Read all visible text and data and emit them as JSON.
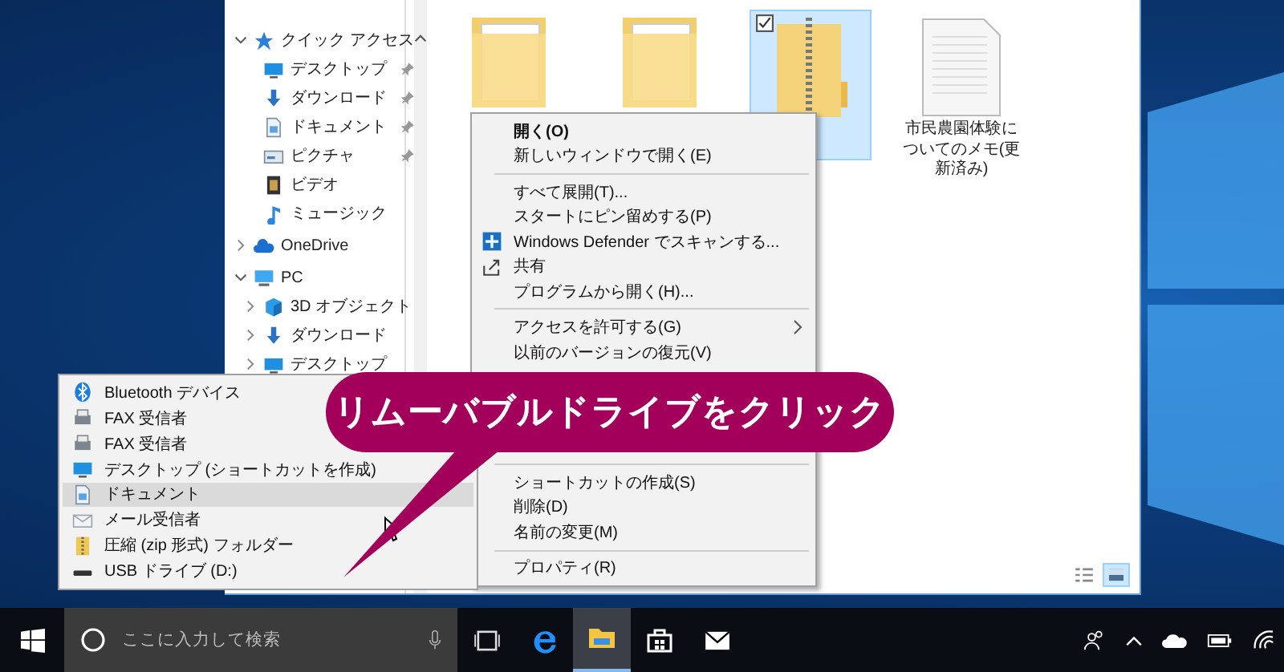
{
  "nav_pane": {
    "items": [
      {
        "label": "クイック アクセス",
        "expanded": true,
        "children": [
          {
            "label": "デスクトップ",
            "pinned": true
          },
          {
            "label": "ダウンロード",
            "pinned": true
          },
          {
            "label": "ドキュメント",
            "pinned": true
          },
          {
            "label": "ピクチャ",
            "pinned": true
          },
          {
            "label": "ビデオ",
            "pinned": false
          },
          {
            "label": "ミュージック",
            "pinned": false
          }
        ]
      },
      {
        "label": "OneDrive",
        "expanded": false
      },
      {
        "label": "PC",
        "expanded": true,
        "children": [
          {
            "label": "3D オブジェクト",
            "expanded": false
          },
          {
            "label": "ダウンロード",
            "expanded": false
          },
          {
            "label": "デスクトップ",
            "expanded": false
          }
        ]
      }
    ]
  },
  "files": [
    {
      "kind": "folder",
      "selected": false
    },
    {
      "kind": "folder",
      "selected": false
    },
    {
      "kind": "zip",
      "selected": true
    },
    {
      "kind": "document",
      "name": "市民農園体験についてのメモ(更新済み)",
      "selected": false
    }
  ],
  "view_buttons": [
    {
      "kind": "details",
      "selected": false
    },
    {
      "kind": "large_icons",
      "selected": true
    }
  ],
  "context_menu": {
    "sections": [
      [
        {
          "label": "開く(O)",
          "default": true
        },
        {
          "label": "新しいウィンドウで開く(E)",
          "default": false
        }
      ],
      [
        {
          "label": "すべて展開(T)..."
        },
        {
          "label": "スタートにピン留めする(P)"
        },
        {
          "label": "Windows Defender でスキャンする..."
        },
        {
          "label": "共有"
        },
        {
          "label": "プログラムから開く(H)..."
        }
      ],
      [
        {
          "label": "アクセスを許可する(G)",
          "submenu": true
        },
        {
          "label": "以前のバージョンの復元(V)",
          "submenu": false
        }
      ],
      [
        {
          "label": "ショートカットの作成(S)"
        },
        {
          "label": "削除(D)"
        },
        {
          "label": "名前の変更(M)"
        }
      ],
      [
        {
          "label": "プロパティ(R)"
        }
      ]
    ]
  },
  "send_to_menu": {
    "items": [
      {
        "label": "Bluetooth デバイス",
        "selected": false
      },
      {
        "label": "FAX 受信者",
        "selected": false
      },
      {
        "label": "FAX 受信者",
        "selected": false
      },
      {
        "label": "デスクトップ (ショートカットを作成)",
        "selected": false
      },
      {
        "label": "ドキュメント",
        "selected": true
      },
      {
        "label": "メール受信者",
        "selected": false
      },
      {
        "label": "圧縮 (zip 形式) フォルダー",
        "selected": false
      },
      {
        "label": "USB ドライブ (D:)",
        "selected": false
      }
    ]
  },
  "callout": {
    "text": "リムーバブルドライブをクリック"
  },
  "taskbar": {
    "search": {
      "placeholder": "ここに入力して検索"
    },
    "apps": [
      {
        "kind": "task_view",
        "selected": false
      },
      {
        "kind": "edge",
        "selected": false
      },
      {
        "kind": "explorer",
        "selected": true
      },
      {
        "kind": "store",
        "selected": false
      },
      {
        "kind": "mail",
        "selected": false
      }
    ]
  }
}
